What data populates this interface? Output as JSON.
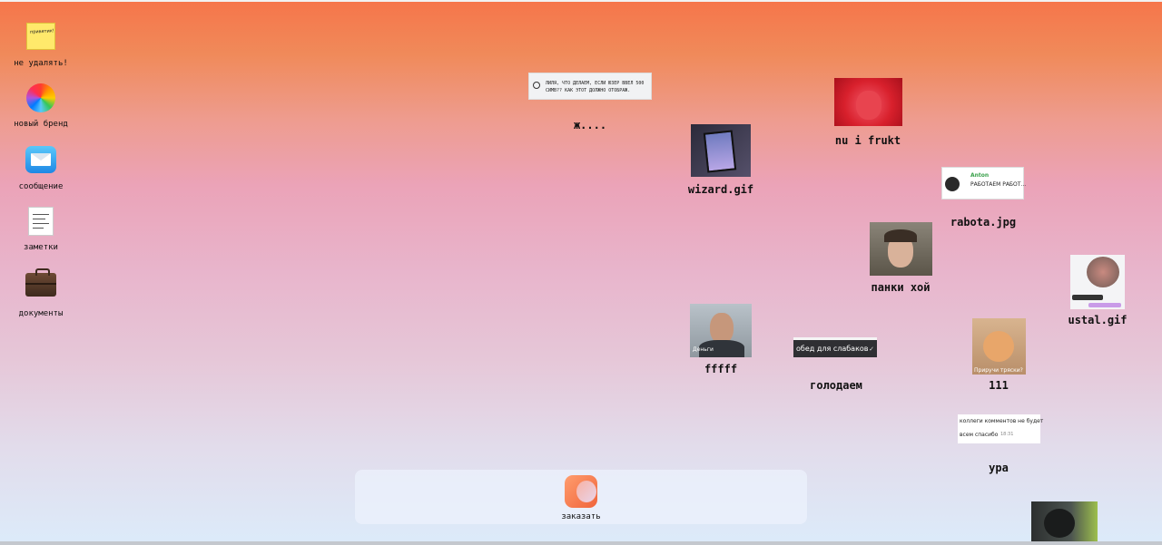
{
  "sidebar": {
    "items": [
      {
        "label": "не удалять!",
        "icon": "sticky-note-icon",
        "note_text": "приветик!"
      },
      {
        "label": "новый бренд",
        "icon": "color-wheel-icon"
      },
      {
        "label": "сообщение",
        "icon": "mail-icon"
      },
      {
        "label": "заметки",
        "icon": "notes-icon"
      },
      {
        "label": "документы",
        "icon": "briefcase-icon"
      }
    ]
  },
  "desktop": {
    "chat_note": {
      "text": "ЛИЛЯ, ЧТО ДЕЛАЕМ, ЕСЛИ ЮЗЕР ВВЕЛ 500 СИМВ?? КАК ЭТОТ ДОЛЖНО ОТОБРАЖ.",
      "label": "ж...."
    },
    "wizard": {
      "label": "wizard.gif"
    },
    "strawberry": {
      "label": "nu i frukt"
    },
    "rabota": {
      "label": "rabota.jpg",
      "sender": "Anton",
      "message": "РАБОТАЕМ РАБОТ..."
    },
    "panki": {
      "label": "панки хой"
    },
    "ustal": {
      "label": "ustal.gif"
    },
    "fffff": {
      "label": "fffff",
      "caption": "Деньги"
    },
    "golodaem": {
      "label": "голодаем",
      "message": "обед для слабаков"
    },
    "cat": {
      "label": "111",
      "caption": "Приручи тряски?"
    },
    "ura": {
      "label": "ура",
      "line1": "коллеги комментов не будет",
      "line2": "всем спасибо",
      "time": "18:31"
    }
  },
  "dock": {
    "app_label": "заказать",
    "app_icon": "order-app-icon"
  },
  "colors": {
    "bg_top": "#f6754a",
    "bg_mid": "#eba3b8",
    "bg_bottom": "#dcebfa"
  }
}
